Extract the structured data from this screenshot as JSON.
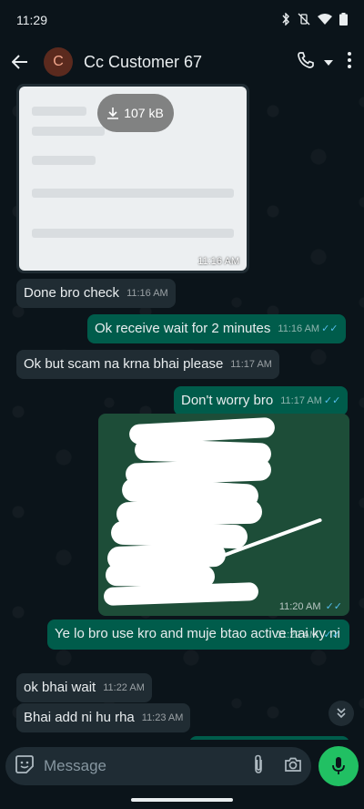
{
  "status_bar": {
    "time": "11:29"
  },
  "header": {
    "avatar_letter": "C",
    "contact_name": "Cc Customer 67"
  },
  "messages": {
    "m0_download_size": "107 kB",
    "m0_time": "11:16 AM",
    "m1_text": "Done bro check",
    "m1_time": "11:16 AM",
    "m2_text": "Ok receive wait for 2 minutes",
    "m2_time": "11:16 AM",
    "m3_text": "Ok but scam na krna bhai please",
    "m3_time": "11:17 AM",
    "m4_text": "Don't worry bro",
    "m4_time": "11:17 AM",
    "m5_time": "11:20 AM",
    "m6_text": "Ye lo bro use kro and muje btao active hai ky ni",
    "m6_time": "11:22 AM",
    "m7_text": "ok bhai wait",
    "m7_time": "11:22 AM",
    "m8_text": "Bhai add ni hu rha",
    "m8_time": "11:23 AM"
  },
  "composer": {
    "placeholder": "Message"
  },
  "colors": {
    "background": "#0b141a",
    "incoming_bubble": "#202c33",
    "outgoing_bubble": "#005c4b",
    "accent_green": "#21c063",
    "read_tick": "#53bdeb"
  }
}
